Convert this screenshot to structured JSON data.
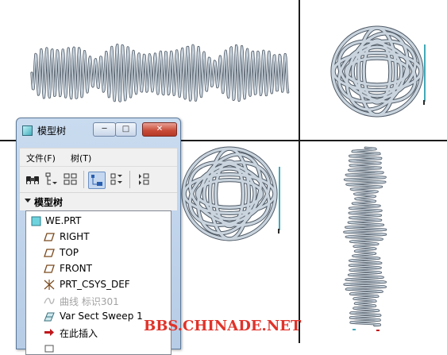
{
  "viewports": [
    {
      "name": "front-view",
      "description_id": "flat-wave"
    },
    {
      "name": "right-view",
      "description_id": "sphere-coil"
    },
    {
      "name": "iso-view",
      "description_id": "sphere-coil"
    },
    {
      "name": "top-view",
      "description_id": "vertical-wave"
    }
  ],
  "model_tree_window": {
    "title": "模型树",
    "buttons": {
      "minimize": "─",
      "maximize": "□",
      "close": "✕"
    },
    "menu": {
      "file": "文件(F)",
      "tree": "树(T)"
    },
    "toolbar_icons": [
      "binoculars-icon",
      "show-filter-icon",
      "columns-icon",
      "tree-view-icon",
      "expand-icon",
      "settings-icon"
    ],
    "tree_header": "模型树",
    "items": [
      {
        "label": "WE.PRT",
        "icon": "part-icon",
        "dim": false
      },
      {
        "label": "RIGHT",
        "icon": "datum-plane-icon",
        "dim": false
      },
      {
        "label": "TOP",
        "icon": "datum-plane-icon",
        "dim": false
      },
      {
        "label": "FRONT",
        "icon": "datum-plane-icon",
        "dim": false
      },
      {
        "label": "PRT_CSYS_DEF",
        "icon": "csys-icon",
        "dim": false
      },
      {
        "label": "曲线 标识301",
        "icon": "curve-icon",
        "dim": true
      },
      {
        "label": "Var Sect Sweep 1",
        "icon": "sweep-icon",
        "dim": false
      },
      {
        "label": "在此插入",
        "icon": "insert-arrow-icon",
        "dim": false
      },
      {
        "label": "",
        "icon": "partial-icon",
        "dim": false
      }
    ]
  },
  "watermark": "BBS.CHINADE.NET",
  "colors": {
    "window_frame": "#b7cce6",
    "close_button": "#c64a36",
    "watermark": "#e0332a",
    "axis_line": "#42aab9",
    "insert_arrow": "#c0161a"
  }
}
